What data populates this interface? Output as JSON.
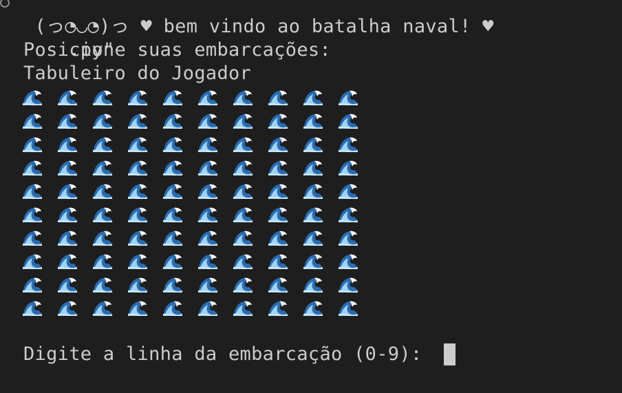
{
  "terminal": {
    "previous_command_fragment": ".py\"",
    "welcome_line": " (っ◔◡◔)っ ♥ bem vindo ao batalha naval! ♥",
    "position_prompt": "Posicione suas embarcações:",
    "board_title": "Tabuleiro do Jogador",
    "board": {
      "rows": 10,
      "cols": 10,
      "cell_symbol": "water-wave-icon"
    },
    "input_prompt": "Digite a linha da embarcação (0-9): ",
    "input_value": ""
  },
  "colors": {
    "background": "#1e1e1e",
    "text": "#cccccc",
    "cursor": "#cccccc",
    "wave_dark": "#2b6cb0",
    "wave_light": "#9fd3f5",
    "foam": "#ffffff"
  }
}
